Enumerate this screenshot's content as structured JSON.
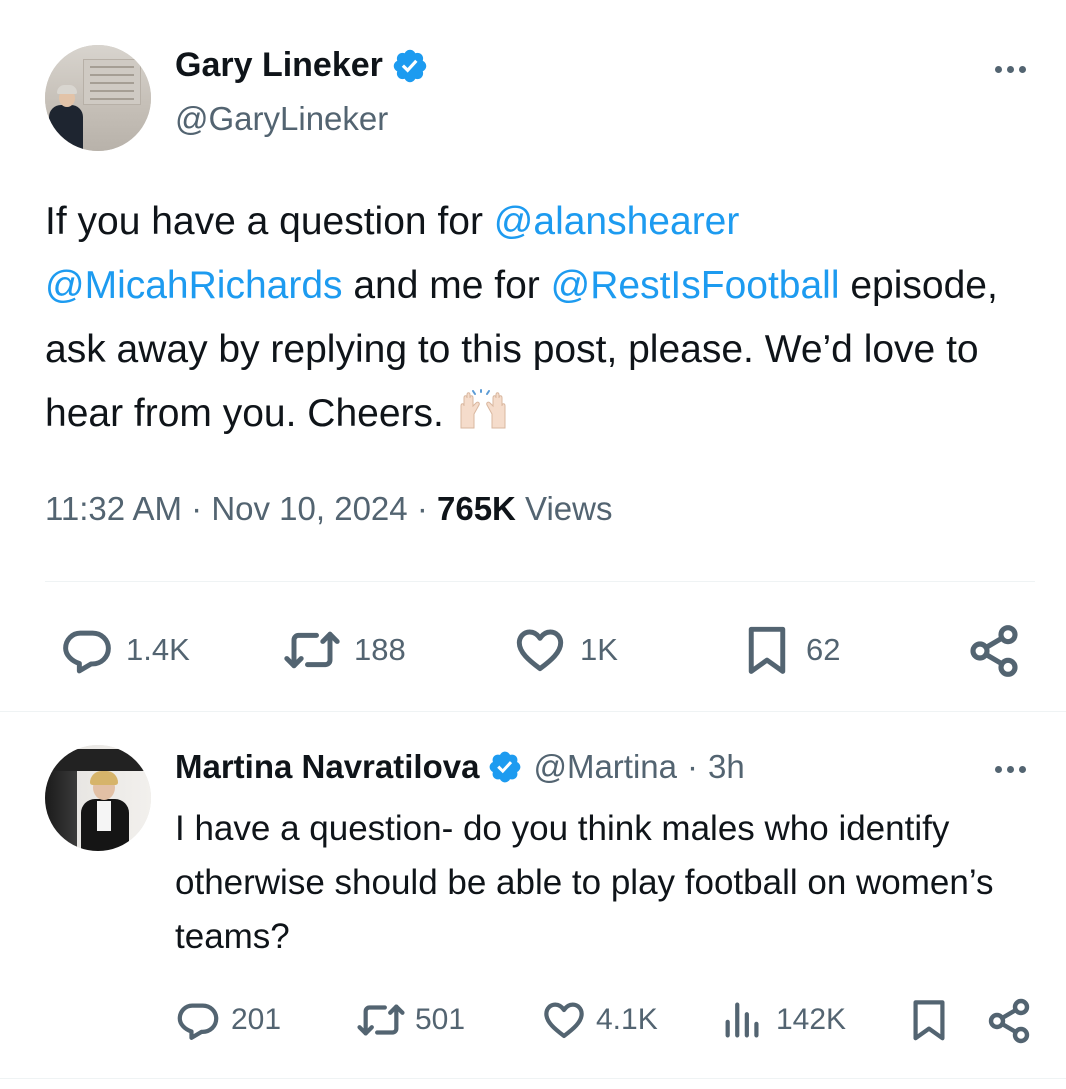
{
  "post": {
    "author_name": "Gary Lineker",
    "author_handle": "@GaryLineker",
    "text_parts": [
      {
        "t": "If you have a question for ",
        "mention": false
      },
      {
        "t": "@alanshearer",
        "mention": true
      },
      {
        "t": " ",
        "mention": false
      },
      {
        "t": "@MicahRichards",
        "mention": true
      },
      {
        "t": " and me for ",
        "mention": false
      },
      {
        "t": "@RestIsFootball",
        "mention": true
      },
      {
        "t": " episode, ask away by replying to this post, please. We’d love to hear from you. Cheers. ",
        "mention": false
      }
    ],
    "emoji": "raising-hands-emoji",
    "time": "11:32 AM",
    "date": "Nov 10, 2024",
    "separator": "·",
    "views_count": "765K",
    "views_label": "Views",
    "actions": {
      "replies": "1.4K",
      "reposts": "188",
      "likes": "1K",
      "bookmarks": "62"
    }
  },
  "reply": {
    "author_name": "Martina Navratilova",
    "author_handle": "@Martina",
    "separator": "·",
    "age": "3h",
    "text": "I have a question- do you think males who identify otherwise should be able to play football on women’s teams?",
    "actions": {
      "replies": "201",
      "reposts": "501",
      "likes": "4.1K",
      "views": "142K"
    }
  },
  "colors": {
    "text": "#0f1419",
    "secondary": "#536471",
    "link": "#1d9bf0",
    "verified": "#1d9bf0",
    "divider": "#eff3f4"
  },
  "icons": [
    "verified-badge-icon",
    "more-options-icon",
    "reply-icon",
    "repost-icon",
    "like-icon",
    "bookmark-icon",
    "share-icon",
    "views-icon"
  ]
}
